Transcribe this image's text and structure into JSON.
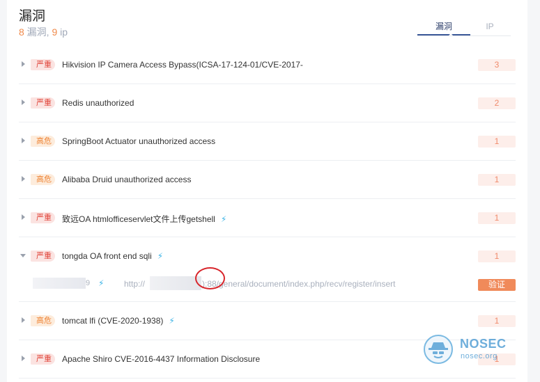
{
  "header": {
    "title": "漏洞",
    "vuln_count": "8",
    "vuln_label": " 漏洞, ",
    "ip_count": "9",
    "ip_label": " ip"
  },
  "tabs": [
    {
      "label": "漏洞",
      "active": true
    },
    {
      "label": "IP",
      "active": false
    }
  ],
  "vulnerabilities": [
    {
      "severity": "严重",
      "level": "serious",
      "name": "Hikvision IP Camera Access Bypass(ICSA-17-124-01/CVE-2017-",
      "exploit": false,
      "count": "3"
    },
    {
      "severity": "严重",
      "level": "serious",
      "name": "Redis unauthorized",
      "exploit": false,
      "count": "2"
    },
    {
      "severity": "高危",
      "level": "high",
      "name": "SpringBoot Actuator unauthorized access",
      "exploit": false,
      "count": "1"
    },
    {
      "severity": "高危",
      "level": "high",
      "name": "Alibaba Druid unauthorized access",
      "exploit": false,
      "count": "1"
    },
    {
      "severity": "严重",
      "level": "serious",
      "name": "致远OA htmlofficeservlet文件上传getshell",
      "exploit": true,
      "count": "1"
    },
    {
      "severity": "严重",
      "level": "serious",
      "name": "tongda OA front end sqli",
      "exploit": true,
      "count": "1"
    },
    {
      "severity": "高危",
      "level": "high",
      "name": "tomcat lfi (CVE-2020-1938)",
      "exploit": true,
      "count": "1"
    },
    {
      "severity": "严重",
      "level": "serious",
      "name": "Apache Shiro CVE-2016-4437 Information Disclosure",
      "exploit": false,
      "count": "1"
    }
  ],
  "expanded_detail": {
    "host_suffix": "9",
    "url_prefix": "http://",
    "url_path": "):88/general/document/index.php/recv/register/insert",
    "verify_label": "验证"
  },
  "watermark": {
    "brand": "NOSEC",
    "domain": "nosec.org"
  },
  "colors": {
    "serious": "#e0453a",
    "high": "#ee8436",
    "exploit_icon": "#3bb3e6",
    "verify_button": "#f08a5a"
  },
  "icons": {
    "exploit": "lightning-bolt-icon",
    "expand": "caret-right-icon"
  }
}
